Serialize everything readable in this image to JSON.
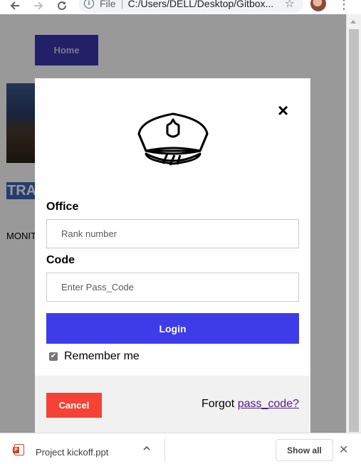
{
  "browser": {
    "url_scheme": "File",
    "url": "C:/Users/DELL/Desktop/Gitbox...",
    "icons": [
      "back-arrow-icon",
      "forward-arrow-icon",
      "reload-icon",
      "info-icon",
      "star-icon",
      "profile-avatar",
      "menu-kebab-icon"
    ]
  },
  "page": {
    "home_label": "Home",
    "hero_title": "TRA",
    "monit_text": "MONIT"
  },
  "modal": {
    "office_label": "Office",
    "office_placeholder": "Rank number",
    "code_label": "Code",
    "code_placeholder": "Enter Pass_Code",
    "login_label": "Login",
    "remember_label": "Remember me",
    "remember_checked": true,
    "cancel_label": "Cancel",
    "forgot_text": "Forgot",
    "forgot_link": "pass_code?",
    "close_symbol": "×",
    "icon": "police-cap-icon"
  },
  "downloads": {
    "file_name": "Project kickoff.ppt",
    "show_all_label": "Show all"
  },
  "colors": {
    "home_button": "#3a37ac",
    "login_button": "#3d3ce8",
    "cancel_button": "#f44336",
    "link": "#551a8b"
  }
}
